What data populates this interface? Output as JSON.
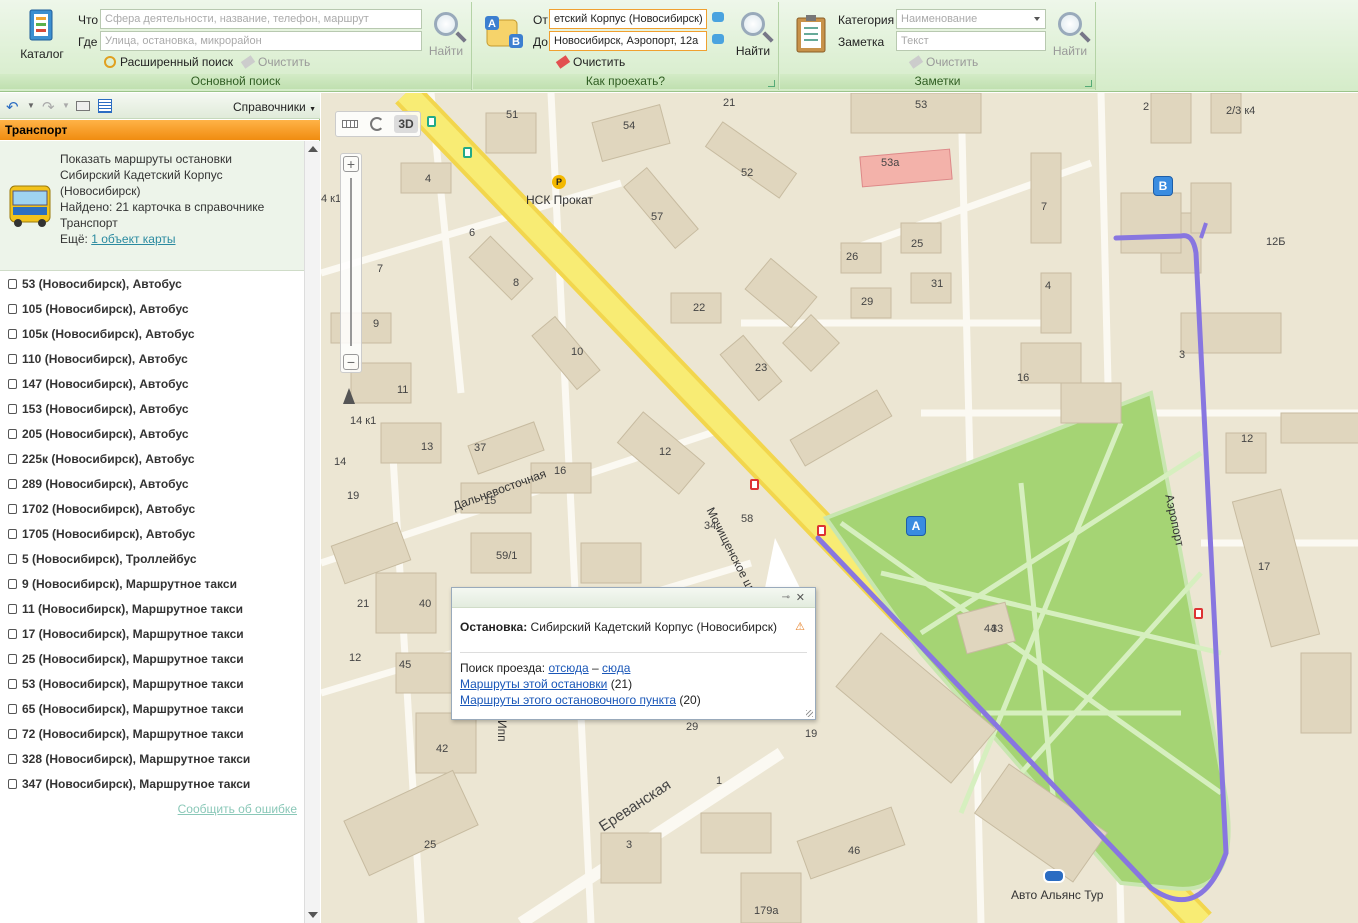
{
  "ribbon": {
    "catalog_label": "Каталог",
    "main_search": {
      "what_label": "Что",
      "what_placeholder": "Сфера деятельности, название, телефон, маршрут",
      "where_label": "Где",
      "where_placeholder": "Улица, остановка, микрорайон",
      "find_label": "Найти",
      "advanced_label": "Расширенный поиск",
      "clear_label": "Очистить",
      "group_title": "Основной поиск"
    },
    "route_search": {
      "from_label": "От",
      "from_value": "етский Корпус (Новосибирск)",
      "to_label": "До",
      "to_value": "Новосибирск, Аэропорт, 12а",
      "find_label": "Найти",
      "clear_label": "Очистить",
      "group_title": "Как проехать?"
    },
    "notes": {
      "category_label": "Категория",
      "category_placeholder": "Наименование",
      "note_label": "Заметка",
      "note_placeholder": "Текст",
      "find_label": "Найти",
      "clear_label": "Очистить",
      "group_title": "Заметки"
    }
  },
  "left_panel": {
    "toolbar_menu": "Справочники",
    "header": "Транспорт",
    "card": {
      "line1": "Показать маршруты остановки",
      "line2": "Сибирский Кадетский Корпус",
      "line3": "(Новосибирск)",
      "found": "Найдено: 21 карточка в справочнике",
      "category": "Транспорт",
      "more_prefix": "Ещё:",
      "more_link": "1 объект карты"
    },
    "routes": [
      "53 (Новосибирск), Автобус",
      "105 (Новосибирск), Автобус",
      "105к (Новосибирск), Автобус",
      "110 (Новосибирск), Автобус",
      "147 (Новосибирск), Автобус",
      "153 (Новосибирск), Автобус",
      "205 (Новосибирск), Автобус",
      "225к (Новосибирск), Автобус",
      "289 (Новосибирск), Автобус",
      "1702 (Новосибирск), Автобус",
      "1705 (Новосибирск), Автобус",
      "5 (Новосибирск), Троллейбус",
      "9 (Новосибирск), Маршрутное такси",
      "11 (Новосибирск), Маршрутное такси",
      "17 (Новосибирск), Маршрутное такси",
      "25 (Новосибирск), Маршрутное такси",
      "53 (Новосибирск), Маршрутное такси",
      "65 (Новосибирск), Маршрутное такси",
      "72 (Новосибирск), Маршрутное такси",
      "328 (Новосибирск), Маршрутное такси",
      "347 (Новосибирск), Маршрутное такси"
    ],
    "report_error": "Сообщить об ошибке"
  },
  "map": {
    "mode_3d": "3D",
    "streets": {
      "mochishchenskoe": "Мочищенское шоссе",
      "dalnevostochnaya": "Дальневосточная",
      "aeroport": "Аэропорт",
      "erevanskaya": "Ереванская",
      "partial1": "Ипп"
    },
    "pois": {
      "nsk_prokat": "НСК Прокат",
      "avto_alyans": "Авто Альянс Тур"
    },
    "marker_a": "A",
    "marker_b": "B",
    "house_numbers": [
      "51",
      "54",
      "21",
      "53",
      "2",
      "2/3 к4",
      "53а",
      "52",
      "57",
      "4",
      "6",
      "8",
      "7",
      "12Б",
      "25",
      "26",
      "29",
      "31",
      "7",
      "4",
      "22",
      "23",
      "12",
      "3",
      "16",
      "9",
      "10",
      "11",
      "13",
      "37",
      "16",
      "15",
      "12",
      "14 к1",
      "14",
      "19",
      "59/1",
      "58",
      "34",
      "33",
      "12",
      "17",
      "21",
      "40",
      "45",
      "42",
      "44",
      "19",
      "1",
      "3",
      "25",
      "46",
      "179а",
      "29",
      "4 к1"
    ]
  },
  "popup": {
    "stop_label": "Остановка:",
    "stop_name": "Сибирский Кадетский Корпус (Новосибирск)",
    "search_label": "Поиск проезда:",
    "from_here": "отсюда",
    "dash": "–",
    "to_here": "сюда",
    "routes_link": "Маршруты этой остановки",
    "routes_count": "(21)",
    "point_link": "Маршруты этого остановочного пункта",
    "point_count": "(20)"
  }
}
